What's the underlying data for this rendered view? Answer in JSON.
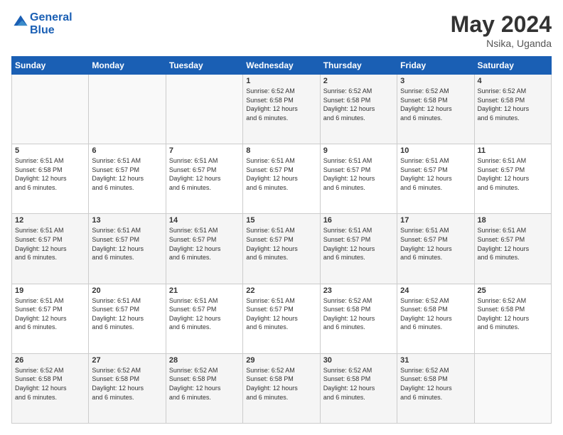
{
  "header": {
    "logo_line1": "General",
    "logo_line2": "Blue",
    "month": "May 2024",
    "location": "Nsika, Uganda"
  },
  "weekdays": [
    "Sunday",
    "Monday",
    "Tuesday",
    "Wednesday",
    "Thursday",
    "Friday",
    "Saturday"
  ],
  "weeks": [
    [
      {
        "day": "",
        "info": ""
      },
      {
        "day": "",
        "info": ""
      },
      {
        "day": "",
        "info": ""
      },
      {
        "day": "1",
        "info": "Sunrise: 6:52 AM\nSunset: 6:58 PM\nDaylight: 12 hours\nand 6 minutes."
      },
      {
        "day": "2",
        "info": "Sunrise: 6:52 AM\nSunset: 6:58 PM\nDaylight: 12 hours\nand 6 minutes."
      },
      {
        "day": "3",
        "info": "Sunrise: 6:52 AM\nSunset: 6:58 PM\nDaylight: 12 hours\nand 6 minutes."
      },
      {
        "day": "4",
        "info": "Sunrise: 6:52 AM\nSunset: 6:58 PM\nDaylight: 12 hours\nand 6 minutes."
      }
    ],
    [
      {
        "day": "5",
        "info": "Sunrise: 6:51 AM\nSunset: 6:58 PM\nDaylight: 12 hours\nand 6 minutes."
      },
      {
        "day": "6",
        "info": "Sunrise: 6:51 AM\nSunset: 6:57 PM\nDaylight: 12 hours\nand 6 minutes."
      },
      {
        "day": "7",
        "info": "Sunrise: 6:51 AM\nSunset: 6:57 PM\nDaylight: 12 hours\nand 6 minutes."
      },
      {
        "day": "8",
        "info": "Sunrise: 6:51 AM\nSunset: 6:57 PM\nDaylight: 12 hours\nand 6 minutes."
      },
      {
        "day": "9",
        "info": "Sunrise: 6:51 AM\nSunset: 6:57 PM\nDaylight: 12 hours\nand 6 minutes."
      },
      {
        "day": "10",
        "info": "Sunrise: 6:51 AM\nSunset: 6:57 PM\nDaylight: 12 hours\nand 6 minutes."
      },
      {
        "day": "11",
        "info": "Sunrise: 6:51 AM\nSunset: 6:57 PM\nDaylight: 12 hours\nand 6 minutes."
      }
    ],
    [
      {
        "day": "12",
        "info": "Sunrise: 6:51 AM\nSunset: 6:57 PM\nDaylight: 12 hours\nand 6 minutes."
      },
      {
        "day": "13",
        "info": "Sunrise: 6:51 AM\nSunset: 6:57 PM\nDaylight: 12 hours\nand 6 minutes."
      },
      {
        "day": "14",
        "info": "Sunrise: 6:51 AM\nSunset: 6:57 PM\nDaylight: 12 hours\nand 6 minutes."
      },
      {
        "day": "15",
        "info": "Sunrise: 6:51 AM\nSunset: 6:57 PM\nDaylight: 12 hours\nand 6 minutes."
      },
      {
        "day": "16",
        "info": "Sunrise: 6:51 AM\nSunset: 6:57 PM\nDaylight: 12 hours\nand 6 minutes."
      },
      {
        "day": "17",
        "info": "Sunrise: 6:51 AM\nSunset: 6:57 PM\nDaylight: 12 hours\nand 6 minutes."
      },
      {
        "day": "18",
        "info": "Sunrise: 6:51 AM\nSunset: 6:57 PM\nDaylight: 12 hours\nand 6 minutes."
      }
    ],
    [
      {
        "day": "19",
        "info": "Sunrise: 6:51 AM\nSunset: 6:57 PM\nDaylight: 12 hours\nand 6 minutes."
      },
      {
        "day": "20",
        "info": "Sunrise: 6:51 AM\nSunset: 6:57 PM\nDaylight: 12 hours\nand 6 minutes."
      },
      {
        "day": "21",
        "info": "Sunrise: 6:51 AM\nSunset: 6:57 PM\nDaylight: 12 hours\nand 6 minutes."
      },
      {
        "day": "22",
        "info": "Sunrise: 6:51 AM\nSunset: 6:57 PM\nDaylight: 12 hours\nand 6 minutes."
      },
      {
        "day": "23",
        "info": "Sunrise: 6:52 AM\nSunset: 6:58 PM\nDaylight: 12 hours\nand 6 minutes."
      },
      {
        "day": "24",
        "info": "Sunrise: 6:52 AM\nSunset: 6:58 PM\nDaylight: 12 hours\nand 6 minutes."
      },
      {
        "day": "25",
        "info": "Sunrise: 6:52 AM\nSunset: 6:58 PM\nDaylight: 12 hours\nand 6 minutes."
      }
    ],
    [
      {
        "day": "26",
        "info": "Sunrise: 6:52 AM\nSunset: 6:58 PM\nDaylight: 12 hours\nand 6 minutes."
      },
      {
        "day": "27",
        "info": "Sunrise: 6:52 AM\nSunset: 6:58 PM\nDaylight: 12 hours\nand 6 minutes."
      },
      {
        "day": "28",
        "info": "Sunrise: 6:52 AM\nSunset: 6:58 PM\nDaylight: 12 hours\nand 6 minutes."
      },
      {
        "day": "29",
        "info": "Sunrise: 6:52 AM\nSunset: 6:58 PM\nDaylight: 12 hours\nand 6 minutes."
      },
      {
        "day": "30",
        "info": "Sunrise: 6:52 AM\nSunset: 6:58 PM\nDaylight: 12 hours\nand 6 minutes."
      },
      {
        "day": "31",
        "info": "Sunrise: 6:52 AM\nSunset: 6:58 PM\nDaylight: 12 hours\nand 6 minutes."
      },
      {
        "day": "",
        "info": ""
      }
    ]
  ]
}
